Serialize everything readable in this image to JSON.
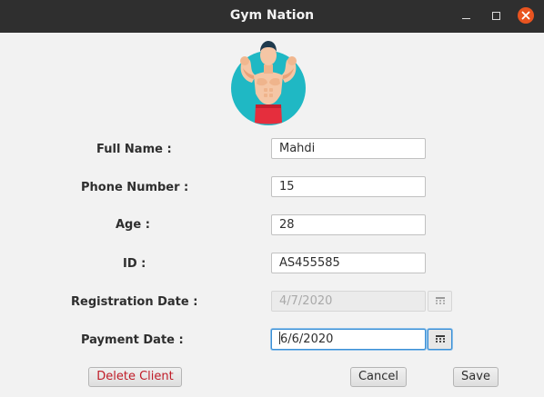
{
  "window": {
    "title": "Gym Nation",
    "controls": {
      "minimize": "minimize-icon",
      "maximize": "maximize-icon",
      "close": "close-icon"
    },
    "close_color": "#e95420"
  },
  "logo": {
    "icon": "bodybuilder-icon",
    "circle_color": "#1fb8c4",
    "shorts_color": "#e52e3d"
  },
  "form": {
    "full_name": {
      "label": "Full Name :",
      "value": "Mahdi"
    },
    "phone_number": {
      "label": "Phone Number :",
      "value": "15"
    },
    "age": {
      "label": "Age :",
      "value": "28"
    },
    "id": {
      "label": "ID :",
      "value": "AS455585"
    },
    "registration_date": {
      "label": "Registration Date :",
      "value": "4/7/2020",
      "disabled": true
    },
    "payment_date": {
      "label": "Payment Date :",
      "value": "6/6/2020",
      "focused": true
    }
  },
  "buttons": {
    "delete": "Delete Client",
    "cancel": "Cancel",
    "save": "Save"
  },
  "colors": {
    "focus": "#3a8fd6",
    "danger_text": "#c01c28"
  }
}
